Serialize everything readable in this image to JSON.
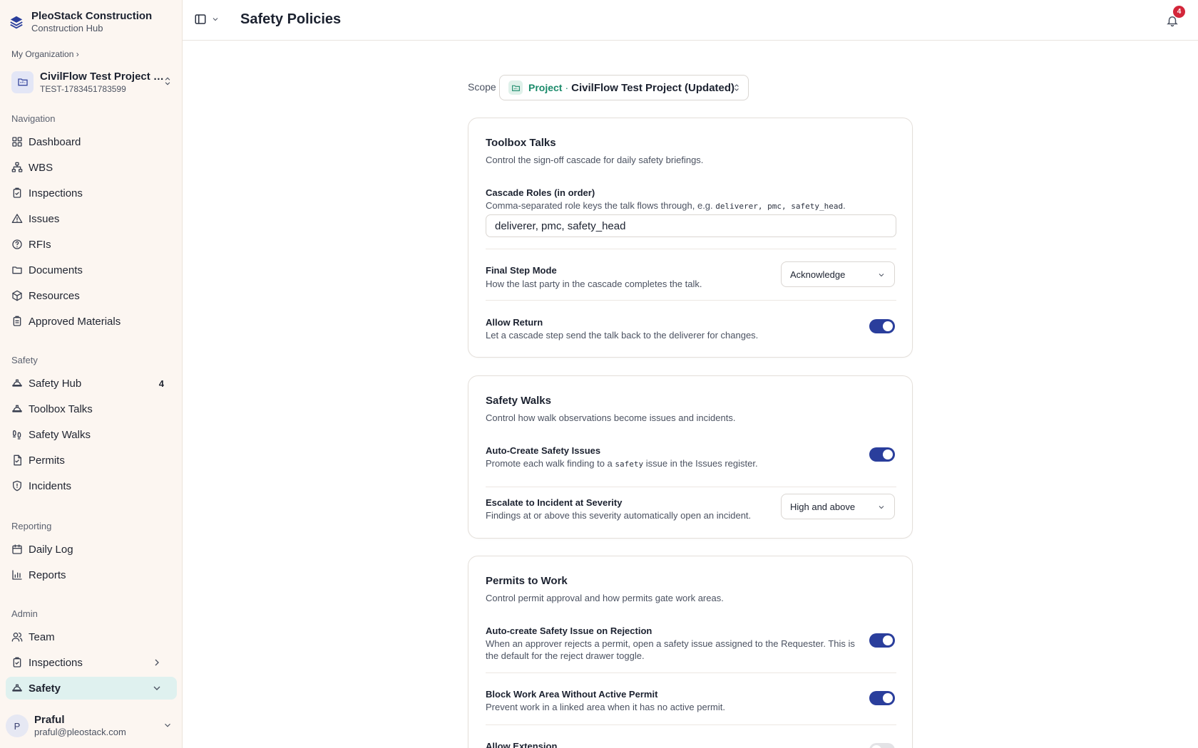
{
  "brand": {
    "name": "PleoStack Construction",
    "subtitle": "Construction Hub"
  },
  "org_crumb": "My Organization",
  "project": {
    "name": "CivilFlow Test Project (U...",
    "code": "TEST-1783451783599"
  },
  "sidebar": {
    "navigation_label": "Navigation",
    "navigation": [
      {
        "label": "Dashboard",
        "icon": "dashboard-icon"
      },
      {
        "label": "WBS",
        "icon": "wbs-icon"
      },
      {
        "label": "Inspections",
        "icon": "clipboard-check-icon"
      },
      {
        "label": "Issues",
        "icon": "warning-triangle-icon"
      },
      {
        "label": "RFIs",
        "icon": "help-circle-icon"
      },
      {
        "label": "Documents",
        "icon": "folder-icon"
      },
      {
        "label": "Resources",
        "icon": "package-icon"
      },
      {
        "label": "Approved Materials",
        "icon": "clipboard-list-icon"
      }
    ],
    "safety_label": "Safety",
    "safety": [
      {
        "label": "Safety Hub",
        "icon": "hard-hat-icon",
        "count": "4"
      },
      {
        "label": "Toolbox Talks",
        "icon": "hard-hat-icon"
      },
      {
        "label": "Safety Walks",
        "icon": "footprints-icon"
      },
      {
        "label": "Permits",
        "icon": "file-check-icon"
      },
      {
        "label": "Incidents",
        "icon": "shield-alert-icon"
      }
    ],
    "reporting_label": "Reporting",
    "reporting": [
      {
        "label": "Daily Log",
        "icon": "calendar-icon"
      },
      {
        "label": "Reports",
        "icon": "bar-chart-icon"
      }
    ],
    "admin_label": "Admin",
    "admin": [
      {
        "label": "Team",
        "icon": "users-icon"
      },
      {
        "label": "Inspections",
        "icon": "clipboard-check-icon"
      },
      {
        "label": "Safety",
        "icon": "hard-hat-icon"
      }
    ]
  },
  "user": {
    "initial": "P",
    "name": "Praful",
    "email": "praful@pleostack.com"
  },
  "header": {
    "title": "Safety Policies",
    "notification_count": "4"
  },
  "scope": {
    "label": "Scope",
    "kind": "Project",
    "separator": "·",
    "name": "CivilFlow Test Project (Updated)"
  },
  "toolbox": {
    "title": "Toolbox Talks",
    "desc": "Control the sign-off cascade for daily safety briefings.",
    "cascade_label": "Cascade Roles (in order)",
    "cascade_help": "Comma-separated role keys the talk flows through, e.g.",
    "cascade_example": "deliverer, pmc, safety_head",
    "cascade_value": "deliverer, pmc, safety_head",
    "final_label": "Final Step Mode",
    "final_help": "How the last party in the cascade completes the talk.",
    "final_value": "Acknowledge",
    "return_label": "Allow Return",
    "return_help": "Let a cascade step send the talk back to the deliverer for changes.",
    "return_on": true
  },
  "walks": {
    "title": "Safety Walks",
    "desc": "Control how walk observations become issues and incidents.",
    "auto_label": "Auto-Create Safety Issues",
    "auto_help_pre": "Promote each walk finding to a",
    "auto_help_code": "safety",
    "auto_help_post": "issue in the Issues register.",
    "auto_on": true,
    "escalate_label": "Escalate to Incident at Severity",
    "escalate_help": "Findings at or above this severity automatically open an incident.",
    "escalate_value": "High and above"
  },
  "permits": {
    "title": "Permits to Work",
    "desc": "Control permit approval and how permits gate work areas.",
    "reject_label": "Auto-create Safety Issue on Rejection",
    "reject_help": "When an approver rejects a permit, open a safety issue assigned to the Requester. This is the default for the reject drawer toggle.",
    "reject_on": true,
    "block_label": "Block Work Area Without Active Permit",
    "block_help": "Prevent work in a linked area when it has no active permit.",
    "block_on": true,
    "extension_label": "Allow Extension",
    "extension_on": false
  },
  "colors": {
    "accent": "#2a3e9c",
    "active_bg": "#dff1ef",
    "sidebar_bg": "#fcf6f1",
    "badge": "#d3263a",
    "scope_green": "#1a8a6a"
  }
}
